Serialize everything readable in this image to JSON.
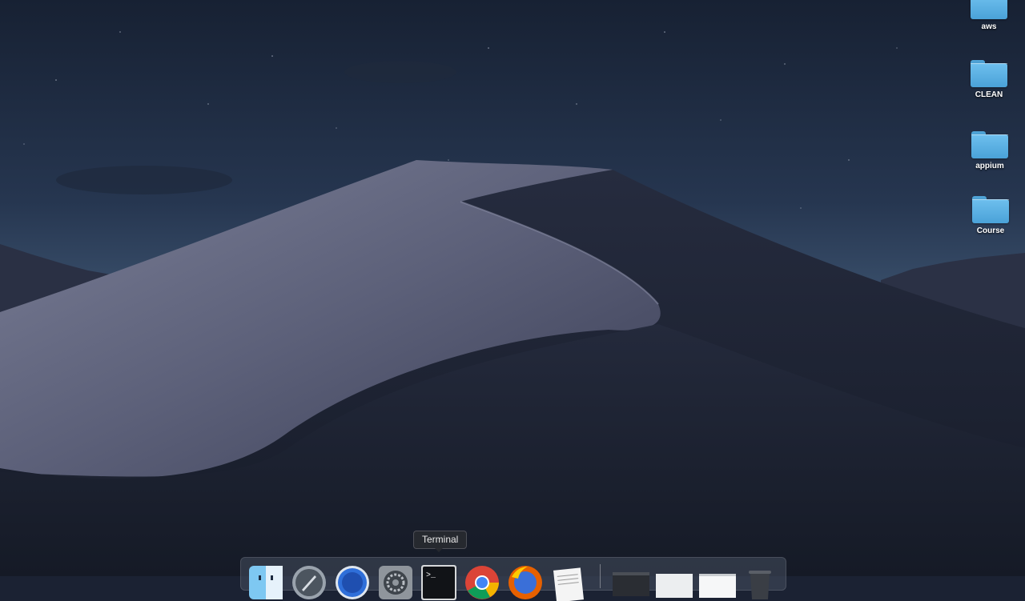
{
  "desktop": {
    "icons": [
      {
        "label": "aws",
        "icon": "folder-icon"
      },
      {
        "label": "CLEAN",
        "icon": "folder-icon"
      },
      {
        "label": "appium",
        "icon": "folder-icon"
      },
      {
        "label": "Course",
        "icon": "folder-icon"
      }
    ]
  },
  "dock": {
    "tooltip": "Terminal",
    "apps": [
      {
        "name": "Finder",
        "icon": "finder-icon"
      },
      {
        "name": "Launchpad",
        "icon": "launchpad-icon"
      },
      {
        "name": "Safari",
        "icon": "safari-icon"
      },
      {
        "name": "System Preferences",
        "icon": "gear-icon"
      },
      {
        "name": "Terminal",
        "icon": "terminal-icon"
      },
      {
        "name": "Chrome",
        "icon": "chrome-icon"
      },
      {
        "name": "Firefox",
        "icon": "firefox-icon"
      },
      {
        "name": "TextEdit",
        "icon": "textedit-icon"
      }
    ],
    "recent": [
      {
        "name": "Window thumbnail",
        "icon": "window-thumbnail-icon"
      },
      {
        "name": "Document thumbnail",
        "icon": "document-thumbnail-icon"
      },
      {
        "name": "Document thumbnail",
        "icon": "document-thumbnail-icon"
      },
      {
        "name": "Trash",
        "icon": "trash-icon"
      }
    ],
    "terminal_prompt": ">_"
  },
  "colors": {
    "sky_top": "#1a2436",
    "sky_bottom": "#3a4d66",
    "folder_blue": "#5db4e8",
    "dune_light": "#6a6f87",
    "dune_shadow": "#1b2030"
  }
}
